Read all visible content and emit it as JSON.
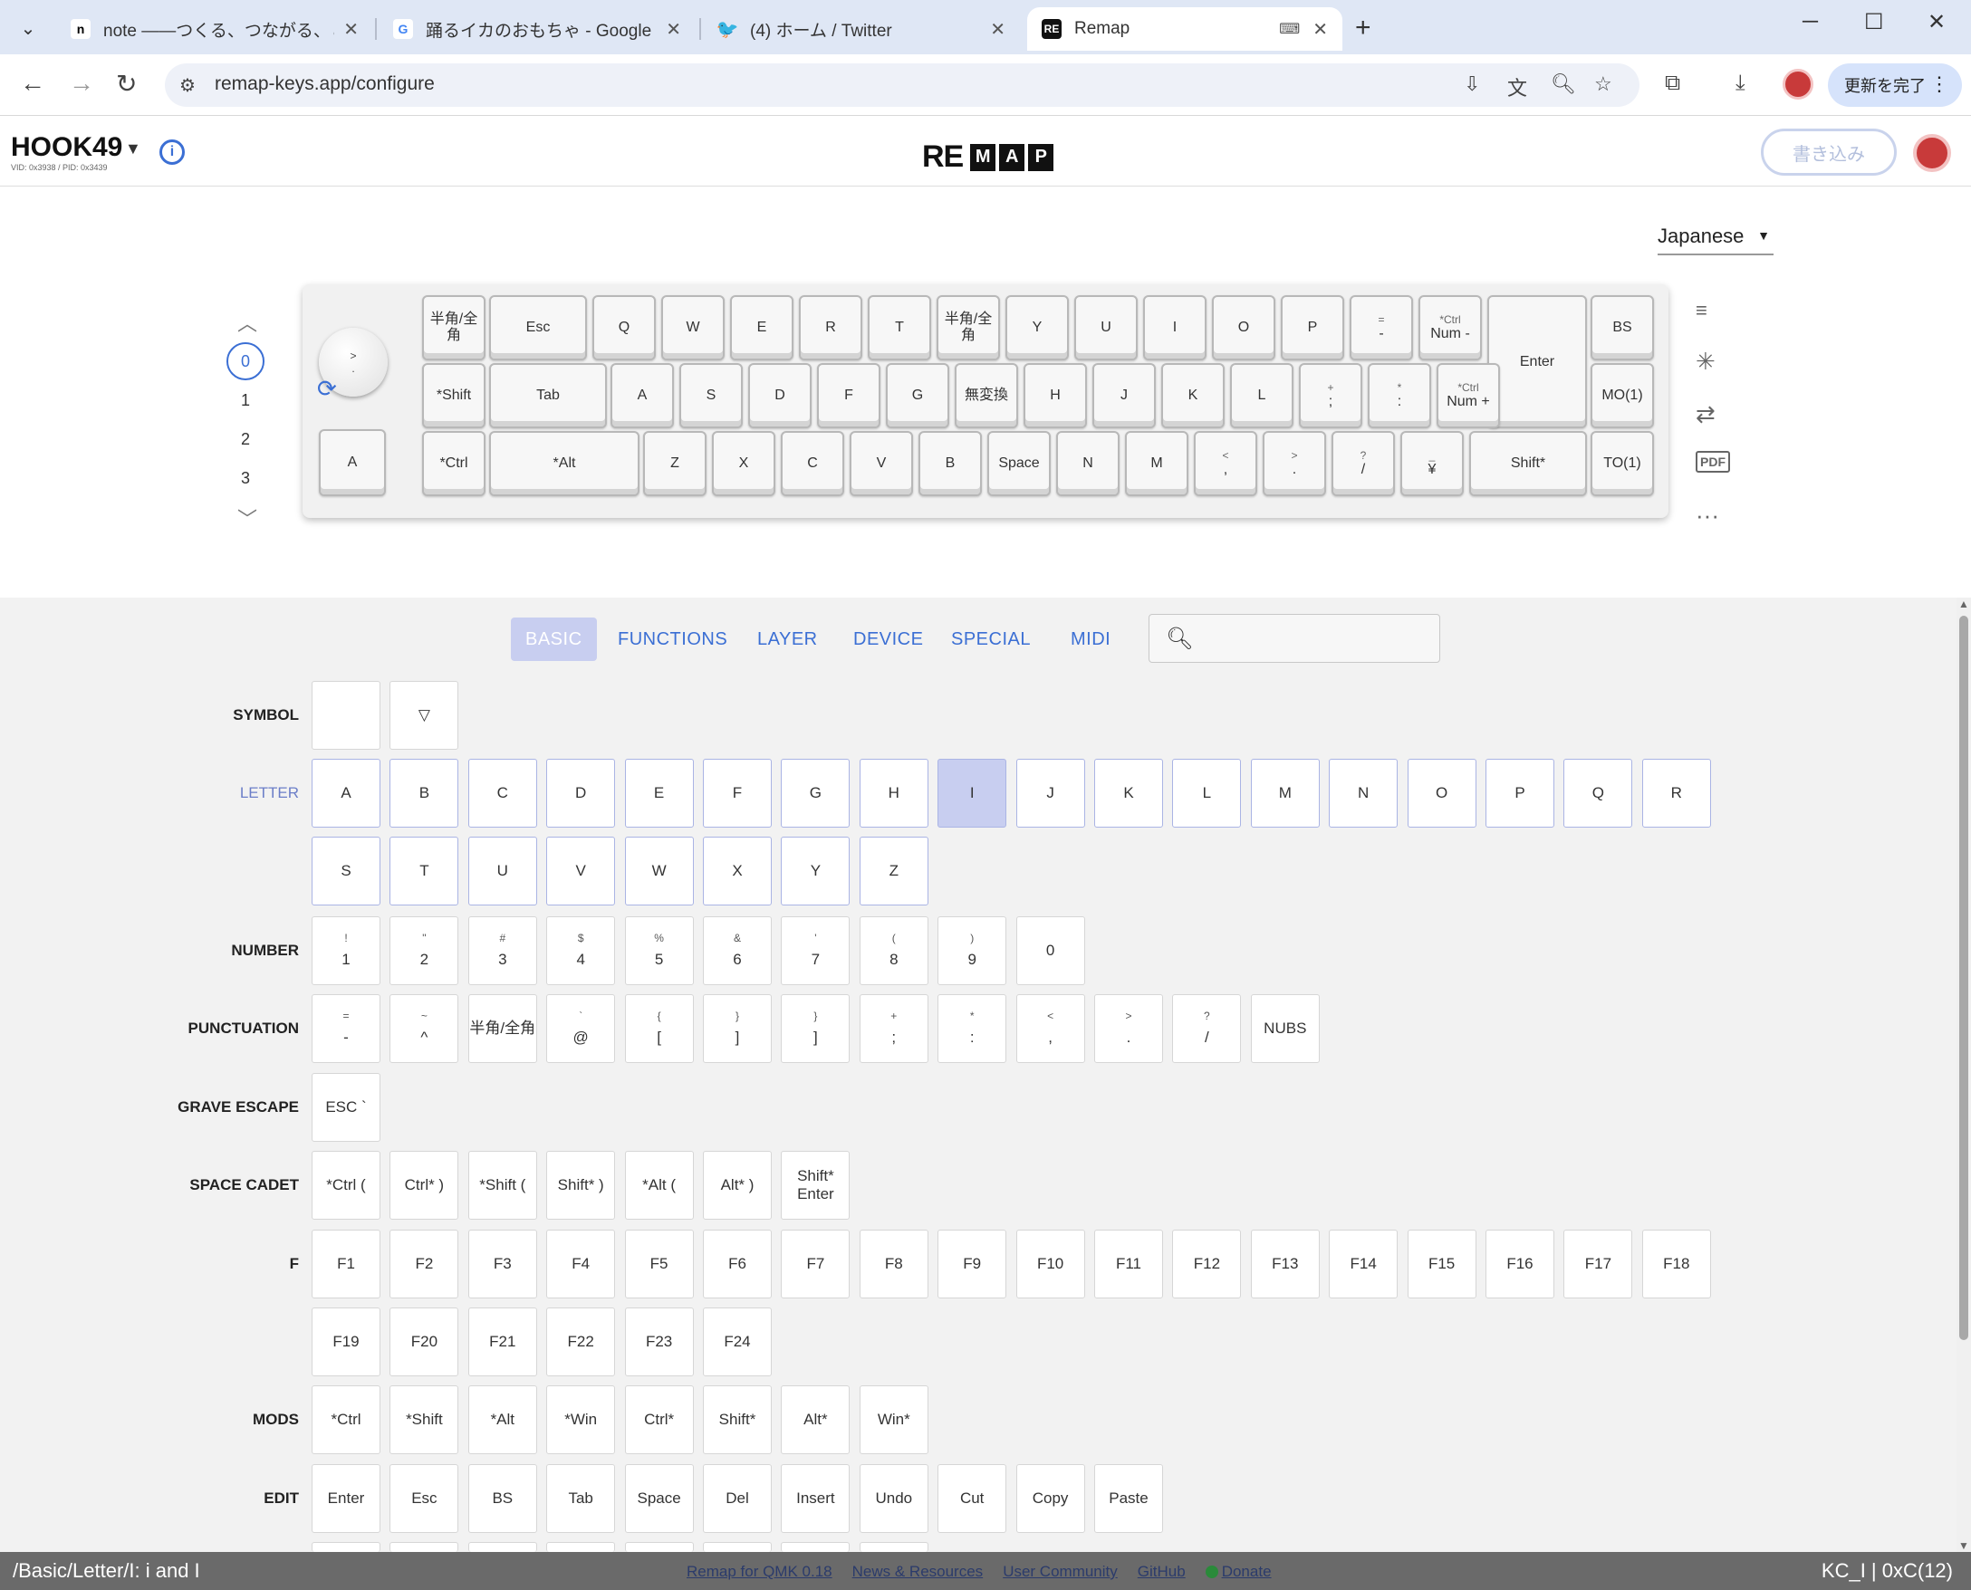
{
  "browser": {
    "tabs": [
      {
        "title": "note ——つくる、つながる、とどける。",
        "favicon": "n",
        "active": false
      },
      {
        "title": "踊るイカのおもちゃ - Google 検索",
        "favicon": "G",
        "active": false
      },
      {
        "title": "(4) ホーム / Twitter",
        "favicon": "bird",
        "active": false
      },
      {
        "title": "Remap",
        "favicon": "RE",
        "active": true
      }
    ],
    "url": "remap-keys.app/configure",
    "update_label": "更新を完了"
  },
  "header": {
    "keyboard_name": "HOOK49",
    "vid_pid": "VID: 0x3938 / PID: 0x3439",
    "logo_prefix": "RE",
    "logo_boxes": [
      "M",
      "A",
      "P"
    ],
    "write_label": "書き込み"
  },
  "keyboard": {
    "language": "Japanese",
    "layers": [
      "0",
      "1",
      "2",
      "3"
    ],
    "selected_layer": "0",
    "knob_top": ">",
    "knob_bottom": ".",
    "encoder_key": "A",
    "row1": [
      {
        "top": "",
        "main": "半角/全角"
      },
      {
        "top": "",
        "main": "Esc"
      },
      {
        "top": "",
        "main": "Q"
      },
      {
        "top": "",
        "main": "W"
      },
      {
        "top": "",
        "main": "E"
      },
      {
        "top": "",
        "main": "R"
      },
      {
        "top": "",
        "main": "T"
      },
      {
        "top": "",
        "main": "半角/全角"
      },
      {
        "top": "",
        "main": "Y"
      },
      {
        "top": "",
        "main": "U"
      },
      {
        "top": "",
        "main": "I"
      },
      {
        "top": "",
        "main": "O"
      },
      {
        "top": "",
        "main": "P"
      },
      {
        "top": "=",
        "main": "-"
      },
      {
        "top": "*Ctrl",
        "main": "Num -"
      },
      {
        "top": "",
        "main": "Enter"
      },
      {
        "top": "",
        "main": "BS"
      }
    ],
    "row2": [
      {
        "top": "",
        "main": "*Shift"
      },
      {
        "top": "",
        "main": "Tab"
      },
      {
        "top": "",
        "main": "A"
      },
      {
        "top": "",
        "main": "S"
      },
      {
        "top": "",
        "main": "D"
      },
      {
        "top": "",
        "main": "F"
      },
      {
        "top": "",
        "main": "G"
      },
      {
        "top": "",
        "main": "無変換"
      },
      {
        "top": "",
        "main": "H"
      },
      {
        "top": "",
        "main": "J"
      },
      {
        "top": "",
        "main": "K"
      },
      {
        "top": "",
        "main": "L"
      },
      {
        "top": "+",
        "main": ";"
      },
      {
        "top": "*",
        "main": ":"
      },
      {
        "top": "*Ctrl",
        "main": "Num +"
      },
      {
        "top": "",
        "main": "MO(1)"
      }
    ],
    "row3": [
      {
        "top": "",
        "main": "*Ctrl"
      },
      {
        "top": "",
        "main": "*Alt"
      },
      {
        "top": "",
        "main": "Z"
      },
      {
        "top": "",
        "main": "X"
      },
      {
        "top": "",
        "main": "C"
      },
      {
        "top": "",
        "main": "V"
      },
      {
        "top": "",
        "main": "B"
      },
      {
        "top": "",
        "main": "Space"
      },
      {
        "top": "",
        "main": "N"
      },
      {
        "top": "",
        "main": "M"
      },
      {
        "top": "<",
        "main": ","
      },
      {
        "top": ">",
        "main": "."
      },
      {
        "top": "?",
        "main": "/"
      },
      {
        "top": "_",
        "main": "¥"
      },
      {
        "top": "",
        "main": "Shift*"
      },
      {
        "top": "",
        "main": "TO(1)"
      }
    ]
  },
  "panel": {
    "tabs": [
      "BASIC",
      "FUNCTIONS",
      "LAYER",
      "DEVICE",
      "SPECIAL",
      "MIDI"
    ],
    "active_tab": "BASIC",
    "search_value": "",
    "labels": {
      "symbol": "SYMBOL",
      "letter": "LETTER",
      "number": "NUMBER",
      "punctuation": "PUNCTUATION",
      "grave": "GRAVE ESCAPE",
      "cadet": "SPACE CADET",
      "f": "F",
      "mods": "MODS",
      "edit": "EDIT"
    },
    "symbol": [
      "",
      "▽"
    ],
    "letters": [
      "A",
      "B",
      "C",
      "D",
      "E",
      "F",
      "G",
      "H",
      "I",
      "J",
      "K",
      "L",
      "M",
      "N",
      "O",
      "P",
      "Q",
      "R",
      "S",
      "T",
      "U",
      "V",
      "W",
      "X",
      "Y",
      "Z"
    ],
    "selected_letter": "I",
    "numbers": [
      {
        "hint": "!",
        "main": "1"
      },
      {
        "hint": "\"",
        "main": "2"
      },
      {
        "hint": "#",
        "main": "3"
      },
      {
        "hint": "$",
        "main": "4"
      },
      {
        "hint": "%",
        "main": "5"
      },
      {
        "hint": "&",
        "main": "6"
      },
      {
        "hint": "'",
        "main": "7"
      },
      {
        "hint": "(",
        "main": "8"
      },
      {
        "hint": ")",
        "main": "9"
      },
      {
        "hint": "",
        "main": "0"
      }
    ],
    "punctuation": [
      {
        "hint": "=",
        "main": "-"
      },
      {
        "hint": "~",
        "main": "^"
      },
      {
        "hint": "",
        "main": "半角/全角"
      },
      {
        "hint": "`",
        "main": "@"
      },
      {
        "hint": "{",
        "main": "["
      },
      {
        "hint": "}",
        "main": "]"
      },
      {
        "hint": "}",
        "main": "]"
      },
      {
        "hint": "+",
        "main": ";"
      },
      {
        "hint": "*",
        "main": ":"
      },
      {
        "hint": "<",
        "main": ","
      },
      {
        "hint": ">",
        "main": "."
      },
      {
        "hint": "?",
        "main": "/"
      },
      {
        "hint": "",
        "main": "NUBS"
      }
    ],
    "grave": [
      "ESC `"
    ],
    "cadet": [
      "*Ctrl (",
      "Ctrl* )",
      "*Shift (",
      "Shift* )",
      "*Alt (",
      "Alt* )",
      "Shift* Enter"
    ],
    "f_keys": [
      "F1",
      "F2",
      "F3",
      "F4",
      "F5",
      "F6",
      "F7",
      "F8",
      "F9",
      "F10",
      "F11",
      "F12",
      "F13",
      "F14",
      "F15",
      "F16",
      "F17",
      "F18",
      "F19",
      "F20",
      "F21",
      "F22",
      "F23",
      "F24"
    ],
    "mods": [
      "*Ctrl",
      "*Shift",
      "*Alt",
      "*Win",
      "Ctrl*",
      "Shift*",
      "Alt*",
      "Win*"
    ],
    "edit": [
      "Enter",
      "Esc",
      "BS",
      "Tab",
      "Space",
      "Del",
      "Insert",
      "Undo",
      "Cut",
      "Copy",
      "Paste"
    ]
  },
  "footer": {
    "path": "/Basic/Letter/I: i and I",
    "links": [
      "Remap for QMK 0.18",
      "News & Resources",
      "User Community",
      "GitHub",
      "Donate"
    ],
    "keycode": "KC_I | 0xC(12)"
  },
  "colors": {
    "accent": "#3b6fd4",
    "selected": "#c8cef0",
    "footer": "#6a6a6a"
  }
}
